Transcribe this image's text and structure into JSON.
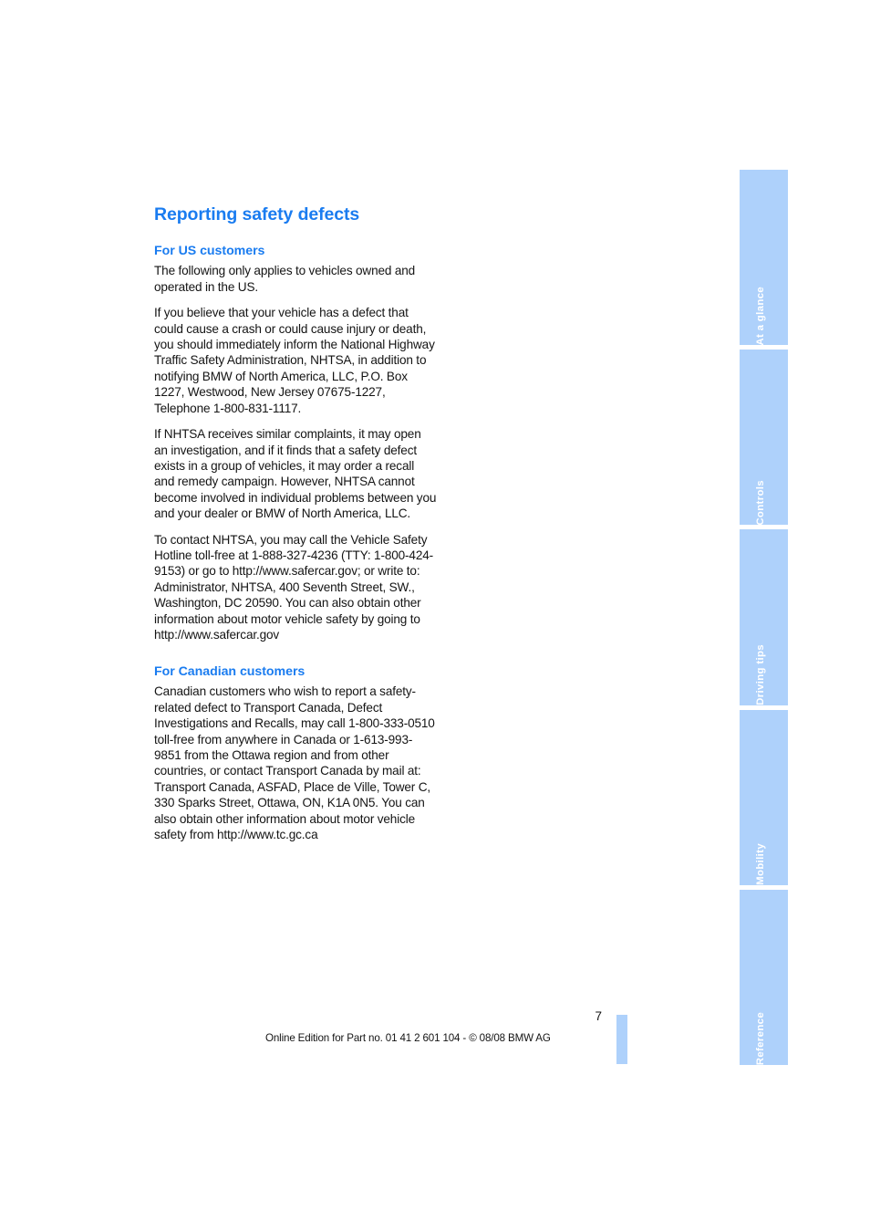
{
  "document": {
    "page_title": "Reporting safety defects",
    "page_number": "7",
    "footer_credit": "Online Edition for Part no. 01 41 2 601 104 - © 08/08 BMW AG",
    "accent_color": "#1a7cf0",
    "tab_color": "#aed1fb",
    "body_color": "#141414"
  },
  "sections": [
    {
      "heading": "For US customers",
      "paragraphs": [
        "The following only applies to vehicles owned and operated in the US.",
        "If you believe that your vehicle has a defect that could cause a crash or could cause injury or death, you should immediately inform the National Highway Traffic Safety Administration, NHTSA, in addition to notifying BMW of North America, LLC, P.O. Box 1227, Westwood, New Jersey 07675-1227, Telephone 1-800-831-1117.",
        "If NHTSA receives similar complaints, it may open an investigation, and if it finds that a safety defect exists in a group of vehicles, it may order a recall and remedy campaign. However, NHTSA cannot become involved in individual problems between you and your dealer or BMW of North America, LLC.",
        "To contact NHTSA, you may call the Vehicle Safety Hotline toll-free at 1-888-327-4236 (TTY: 1-800-424-9153) or go to http://www.safercar.gov; or write to: Administrator, NHTSA, 400 Seventh Street, SW., Washington, DC 20590. You can also obtain other information about motor vehicle safety by going to http://www.safercar.gov"
      ]
    },
    {
      "heading": "For Canadian customers",
      "paragraphs": [
        "Canadian customers who wish to report a safety-related defect to Transport Canada, Defect Investigations and Recalls, may call 1-800-333-0510 toll-free from anywhere in Canada or 1-613-993-9851 from the Ottawa region and from other countries, or contact Transport Canada by mail at: Transport Canada, ASFAD, Place de Ville, Tower C, 330 Sparks Street, Ottawa, ON, K1A 0N5. You can also obtain other information about motor vehicle safety from http://www.tc.gc.ca"
      ]
    }
  ],
  "chapter_tabs": [
    {
      "label": "At a glance"
    },
    {
      "label": "Controls"
    },
    {
      "label": "Driving tips"
    },
    {
      "label": "Mobility"
    },
    {
      "label": "Reference"
    }
  ]
}
